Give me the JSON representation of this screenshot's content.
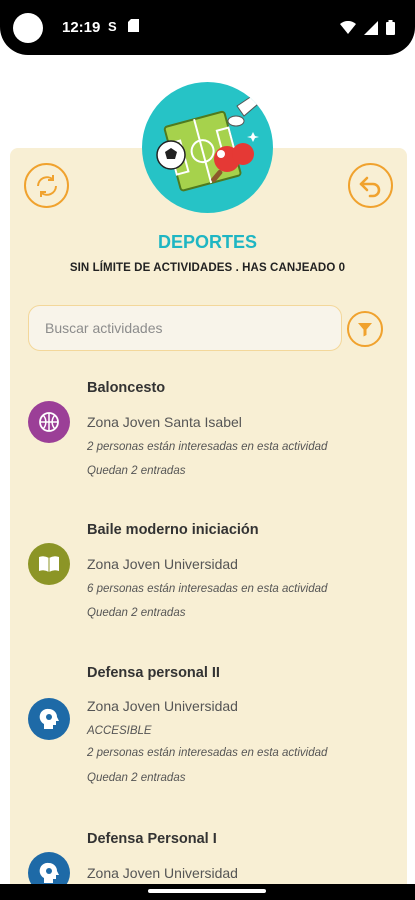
{
  "status": {
    "time": "12:19",
    "s_icon": "S"
  },
  "header": {
    "title": "DEPORTES",
    "subtitle": "SIN LÍMITE DE ACTIVIDADES . HAS CANJEADO 0"
  },
  "search": {
    "placeholder": "Buscar actividades"
  },
  "activities": [
    {
      "title": "Baloncesto",
      "location": "Zona Joven Santa Isabel",
      "interest": "2 personas están interesadas en esta actividad",
      "remaining": "Quedan 2 entradas",
      "icon": "basketball-icon",
      "color": "#9b3f97"
    },
    {
      "title": "Baile moderno iniciación",
      "location": "Zona Joven Universidad",
      "interest": "6 personas están interesadas en esta actividad",
      "remaining": "Quedan 2 entradas",
      "icon": "book-icon",
      "color": "#8c9526"
    },
    {
      "title": "Defensa personal II",
      "location": "Zona Joven Universidad",
      "tag": "ACCESIBLE",
      "interest": "2 personas están interesadas en esta actividad",
      "remaining": "Quedan 2 entradas",
      "icon": "head-gear-icon",
      "color": "#1e6aa7"
    },
    {
      "title": "Defensa Personal I",
      "location": "Zona Joven Universidad",
      "icon": "head-gear-icon",
      "color": "#1e6aa7"
    }
  ],
  "colors": {
    "accent": "#f0a22e",
    "title": "#1fb6c3",
    "card": "#f8efd4",
    "hero": "#26c3c6"
  }
}
